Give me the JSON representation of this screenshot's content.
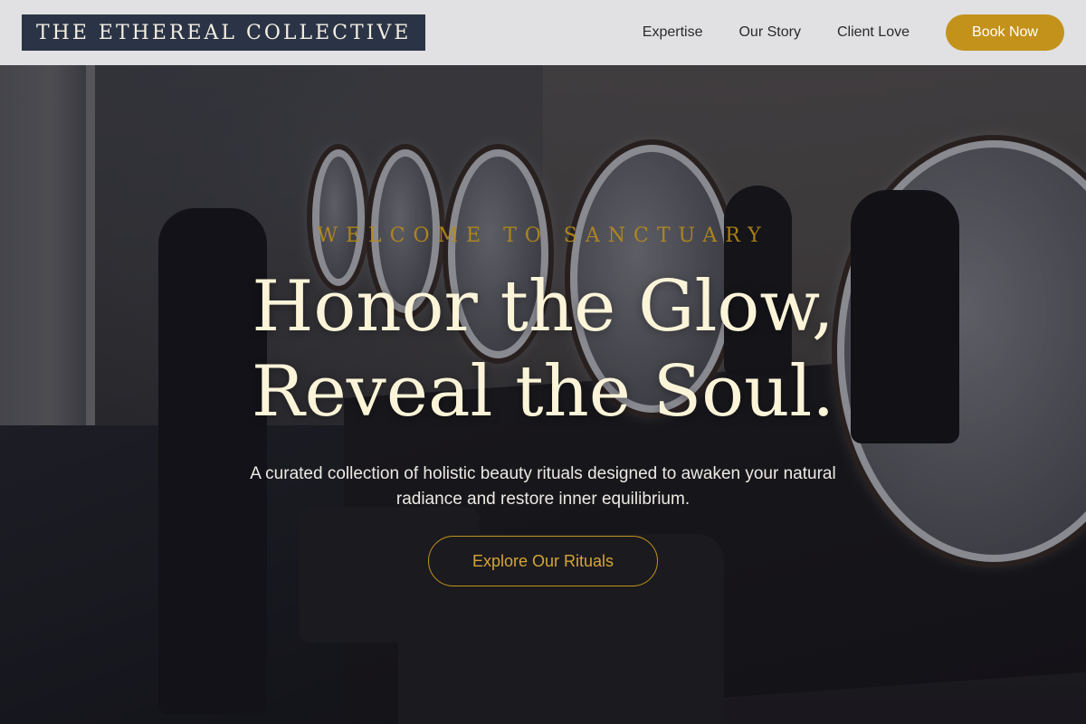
{
  "header": {
    "logo": "THE ETHEREAL COLLECTIVE",
    "nav": [
      {
        "label": "Expertise"
      },
      {
        "label": "Our Story"
      },
      {
        "label": "Client Love"
      }
    ],
    "cta_label": "Book Now"
  },
  "hero": {
    "eyebrow": "WELCOME TO SANCTUARY",
    "headline_line1": "Honor the Glow,",
    "headline_line2": "Reveal the Soul.",
    "subtext": "A curated collection of holistic beauty rituals designed to awaken your natural radiance and restore inner equilibrium.",
    "cta_label": "Explore Our Rituals"
  },
  "colors": {
    "accent_gold": "#c3921a",
    "logo_bg": "#2b3446",
    "headline": "#fbf4d8"
  }
}
